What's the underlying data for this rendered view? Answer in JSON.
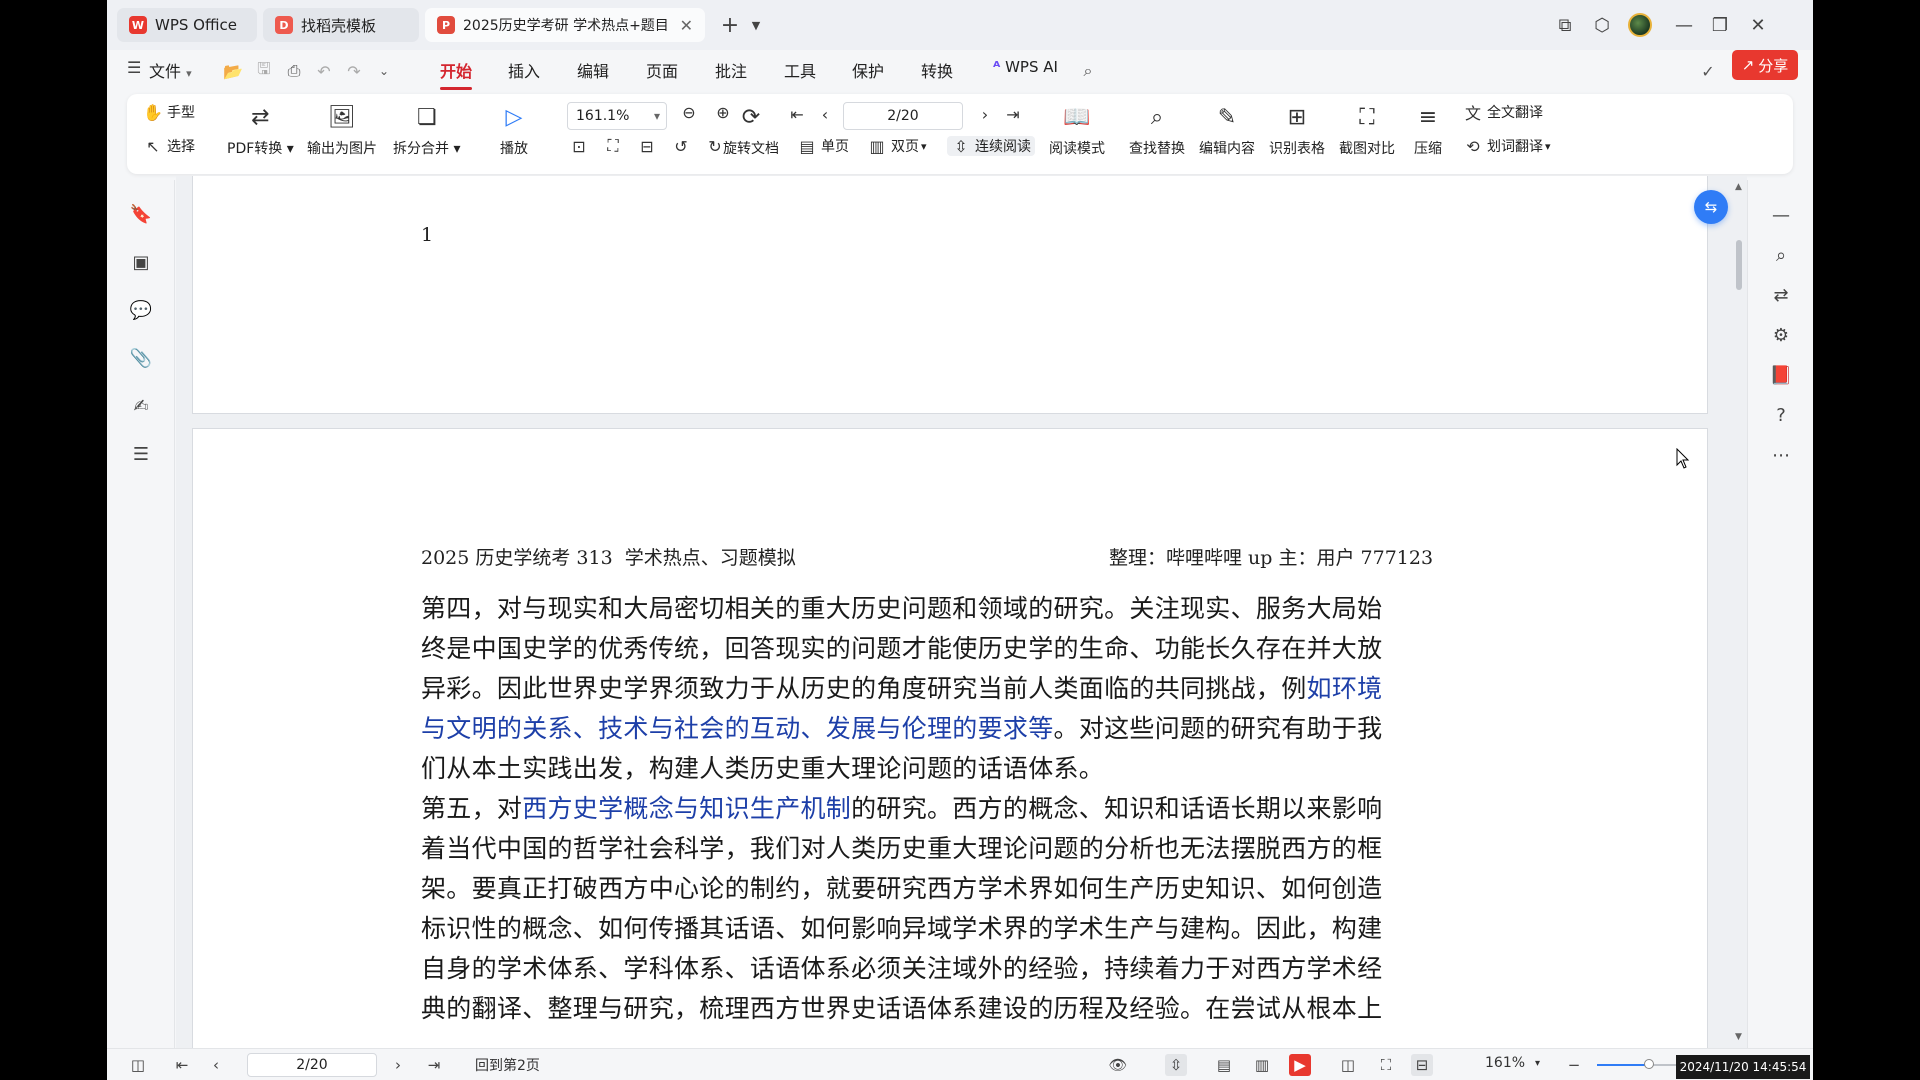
{
  "window": {
    "tabs": [
      {
        "label": "WPS Office",
        "icon": "wps-logo-icon"
      },
      {
        "label": "找稻壳模板",
        "icon": "docer-icon"
      },
      {
        "label": "2025历史学考研 学术热点+题目",
        "icon": "pdf-icon"
      }
    ],
    "new_tab": "+"
  },
  "menu": {
    "file": "文件",
    "tabs": [
      "开始",
      "插入",
      "编辑",
      "页面",
      "批注",
      "工具",
      "保护",
      "转换"
    ],
    "active_tab": "开始",
    "wps_ai": "WPS AI",
    "share": "分享"
  },
  "ribbon": {
    "hand": "手型",
    "select": "选择",
    "pdf_convert": "PDF转换",
    "export_image": "输出为图片",
    "split_merge": "拆分合并",
    "play": "播放",
    "zoom": "161.1%",
    "rotate": "旋转文档",
    "single_page": "单页",
    "double_page": "双页",
    "continuous": "连续阅读",
    "read_mode": "阅读模式",
    "find_replace": "查找替换",
    "edit_content": "编辑内容",
    "recognize_table": "识别表格",
    "screenshot_compare": "截图对比",
    "compress": "压缩",
    "full_translate": "全文翻译",
    "word_translate": "划词翻译",
    "page_indicator": "2/20"
  },
  "document": {
    "page1_number": "1",
    "header_left": "2025 历史学统考 313  学术热点、习题模拟",
    "header_right": "整理：哔哩哔哩 up 主：用户 777123",
    "lines": [
      {
        "t": "第四，对与现实和大局密切相关的重大历史问题和领域的研究。关注现实、服务大局始"
      },
      {
        "t": "终是中国史学的优秀传统，回答现实的问题才能使历史学的生命、功能长久存在并大放"
      },
      {
        "t": "异彩。因此世界史学界须致力于从历史的角度研究当前人类面临的共同挑战，例",
        "hl": "如环境"
      },
      {
        "hl0": "与文明的关系、技术与社会的互动、发展与伦理的要求等",
        "t": "。对这些问题的研究有助于我"
      },
      {
        "t": "们从本土实践出发，构建人类历史重大理论问题的话语体系。"
      },
      {
        "t0": "第五，对",
        "hl": "西方史学概念与知识生产机制",
        "t": "的研究。西方的概念、知识和话语长期以来影响"
      },
      {
        "t": "着当代中国的哲学社会科学，我们对人类历史重大理论问题的分析也无法摆脱西方的框"
      },
      {
        "t": "架。要真正打破西方中心论的制约，就要研究西方学术界如何生产历史知识、如何创造"
      },
      {
        "t": "标识性的概念、如何传播其话语、如何影响异域学术界的学术生产与建构。因此，构建"
      },
      {
        "t": "自身的学术体系、学科体系、话语体系必须关注域外的经验，持续着力于对西方学术经"
      },
      {
        "t": "典的翻译、整理与研究，梳理西方世界史话语体系建设的历程及经验。在尝试从根本上"
      }
    ]
  },
  "statusbar": {
    "page": "2/20",
    "back_to_page": "回到第2页",
    "zoom": "161%",
    "zoom_fraction": 0.47,
    "datetime": "2024/11/20 14:45:54"
  },
  "colors": {
    "accent_red": "#d4262f",
    "highlight_blue": "#1d3fa8",
    "share_red": "#e8382f",
    "float_blue": "#2f7cf6"
  }
}
